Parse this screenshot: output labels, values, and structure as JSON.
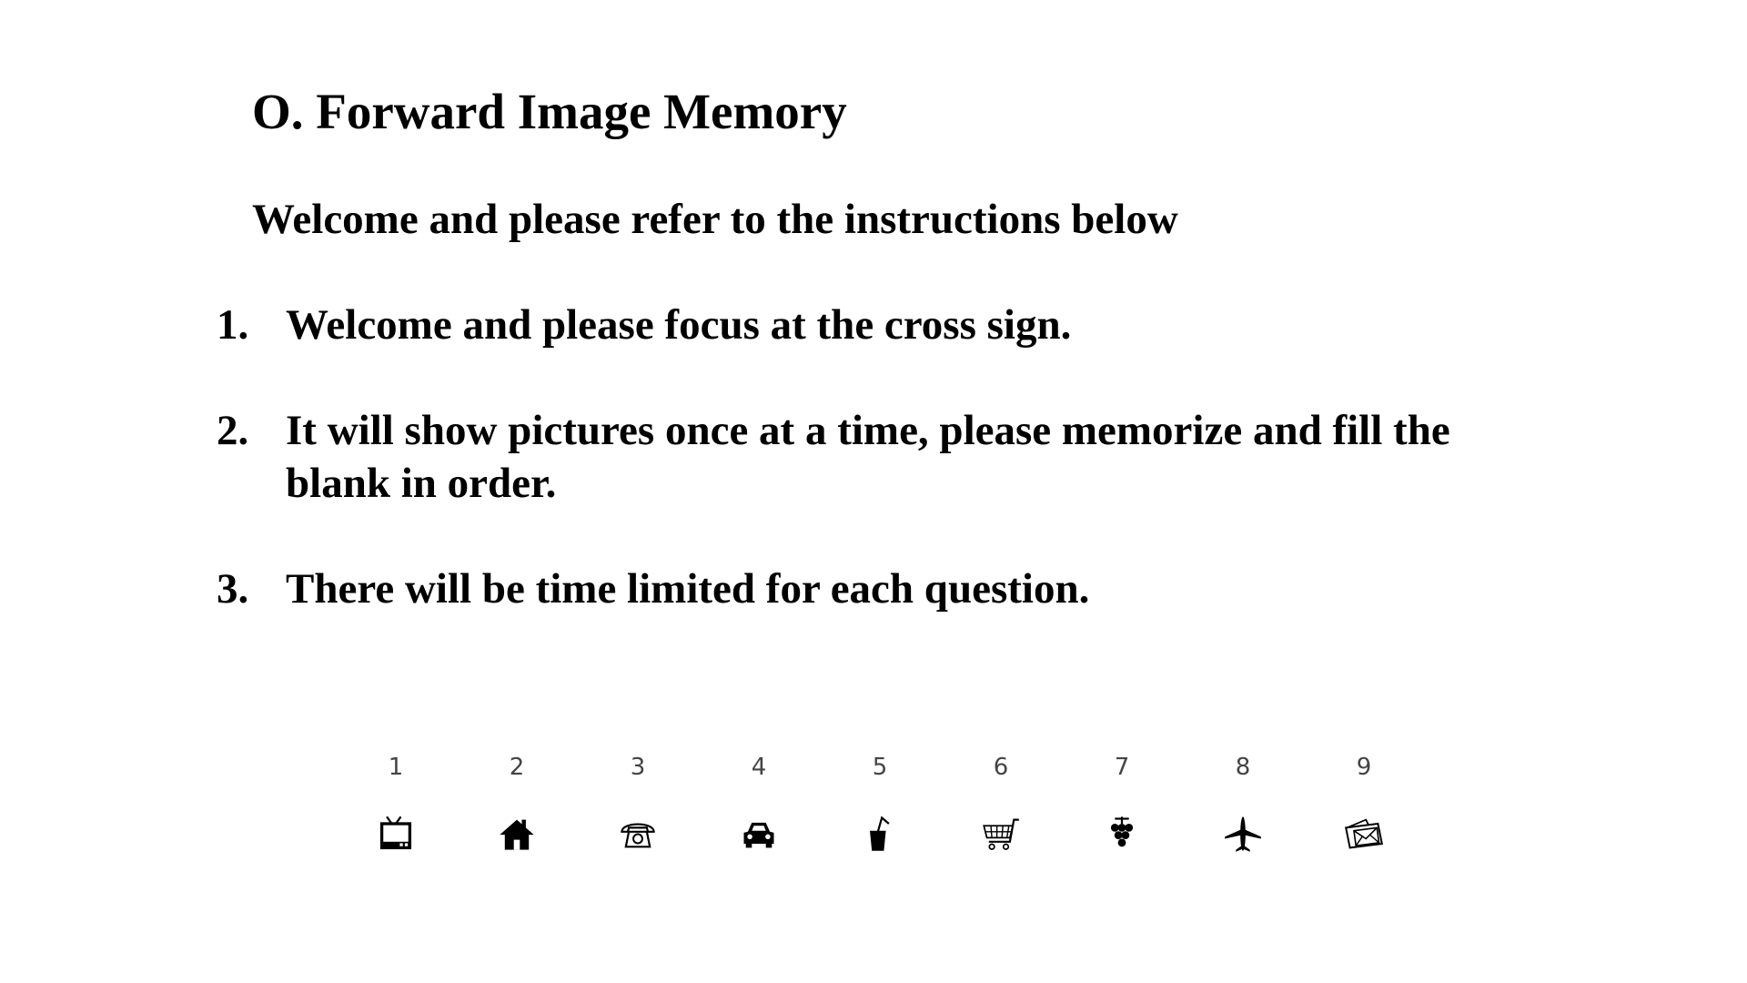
{
  "slide": {
    "title": "O. Forward Image Memory",
    "subtitle": "Welcome and please refer to the instructions below",
    "steps": [
      {
        "num": "1.",
        "text": "Welcome and please focus at the cross sign."
      },
      {
        "num": "2.",
        "text": "It will show pictures once at a time, please memorize and fill the blank in order."
      },
      {
        "num": "3.",
        "text": "There will be time limited for each question."
      }
    ]
  },
  "icons": [
    {
      "num": "1",
      "icon": "tv-icon"
    },
    {
      "num": "2",
      "icon": "house-icon"
    },
    {
      "num": "3",
      "icon": "telephone-icon"
    },
    {
      "num": "4",
      "icon": "car-icon"
    },
    {
      "num": "5",
      "icon": "drink-cup-icon"
    },
    {
      "num": "6",
      "icon": "shopping-cart-icon"
    },
    {
      "num": "7",
      "icon": "grapes-icon"
    },
    {
      "num": "8",
      "icon": "airplane-icon"
    },
    {
      "num": "9",
      "icon": "mail-envelope-icon"
    }
  ]
}
